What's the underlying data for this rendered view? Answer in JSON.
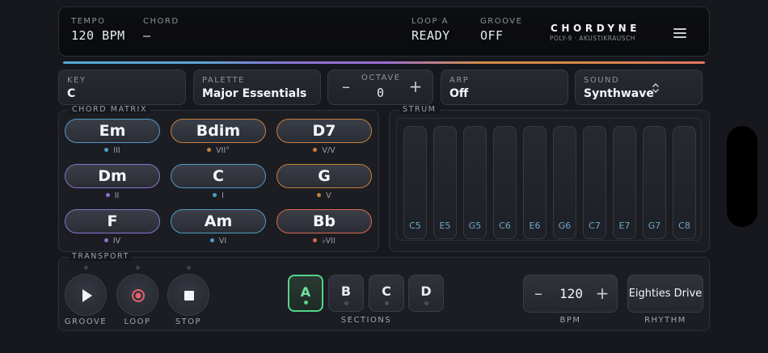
{
  "display": {
    "tempo_label": "TEMPO",
    "tempo_value": "120 BPM",
    "chord_label": "CHORD",
    "chord_value": "—",
    "loop_label": "LOOP A",
    "loop_value": "READY",
    "groove_label": "GROOVE",
    "groove_value": "OFF",
    "brand_name": "CHORDYNE",
    "brand_sub": "POLY-9 · AKUSTIKRAUSCH",
    "menu_icon": "menu-icon"
  },
  "selectors": {
    "key": {
      "label": "KEY",
      "value": "C"
    },
    "palette": {
      "label": "PALETTE",
      "value": "Major Essentials"
    },
    "octave": {
      "label": "OCTAVE",
      "value": "0",
      "minus": "–",
      "plus": "+"
    },
    "arp": {
      "label": "ARP",
      "value": "Off"
    },
    "sound": {
      "label": "SOUND",
      "value": "Synthwave",
      "icon": "updown-chevron-icon"
    }
  },
  "chord_matrix": {
    "title": "CHORD MATRIX",
    "chords": [
      {
        "name": "Em",
        "degree": "III",
        "color": "#4f9cc8"
      },
      {
        "name": "Bdim",
        "degree": "VII°",
        "color": "#c9803f"
      },
      {
        "name": "D7",
        "degree": "V/V",
        "color": "#c9803f"
      },
      {
        "name": "Dm",
        "degree": "II",
        "color": "#8a73d0"
      },
      {
        "name": "C",
        "degree": "I",
        "color": "#4f9cc8"
      },
      {
        "name": "G",
        "degree": "V",
        "color": "#c9803f"
      },
      {
        "name": "F",
        "degree": "IV",
        "color": "#8a73d0"
      },
      {
        "name": "Am",
        "degree": "VI",
        "color": "#4f9cc8"
      },
      {
        "name": "Bb",
        "degree": "♭VII",
        "color": "#d9694d"
      }
    ]
  },
  "strum": {
    "title": "STRUM",
    "notes": [
      "C5",
      "E5",
      "G5",
      "C6",
      "E6",
      "G6",
      "C7",
      "E7",
      "G7",
      "C8"
    ]
  },
  "transport": {
    "title": "TRANSPORT",
    "groove_label": "GROOVE",
    "loop_label": "LOOP",
    "stop_label": "STOP",
    "sections_label": "SECTIONS",
    "sections": [
      "A",
      "B",
      "C",
      "D"
    ],
    "active_section": "A",
    "bpm_value": "120",
    "bpm_minus": "–",
    "bpm_plus": "+",
    "bpm_label": "BPM",
    "rhythm_value": "Eighties Drive",
    "rhythm_label": "RHYTHM"
  },
  "colors": {
    "accent_green": "#54d38a",
    "record_red": "#e8606a",
    "note_blue": "#6fa6c8"
  }
}
